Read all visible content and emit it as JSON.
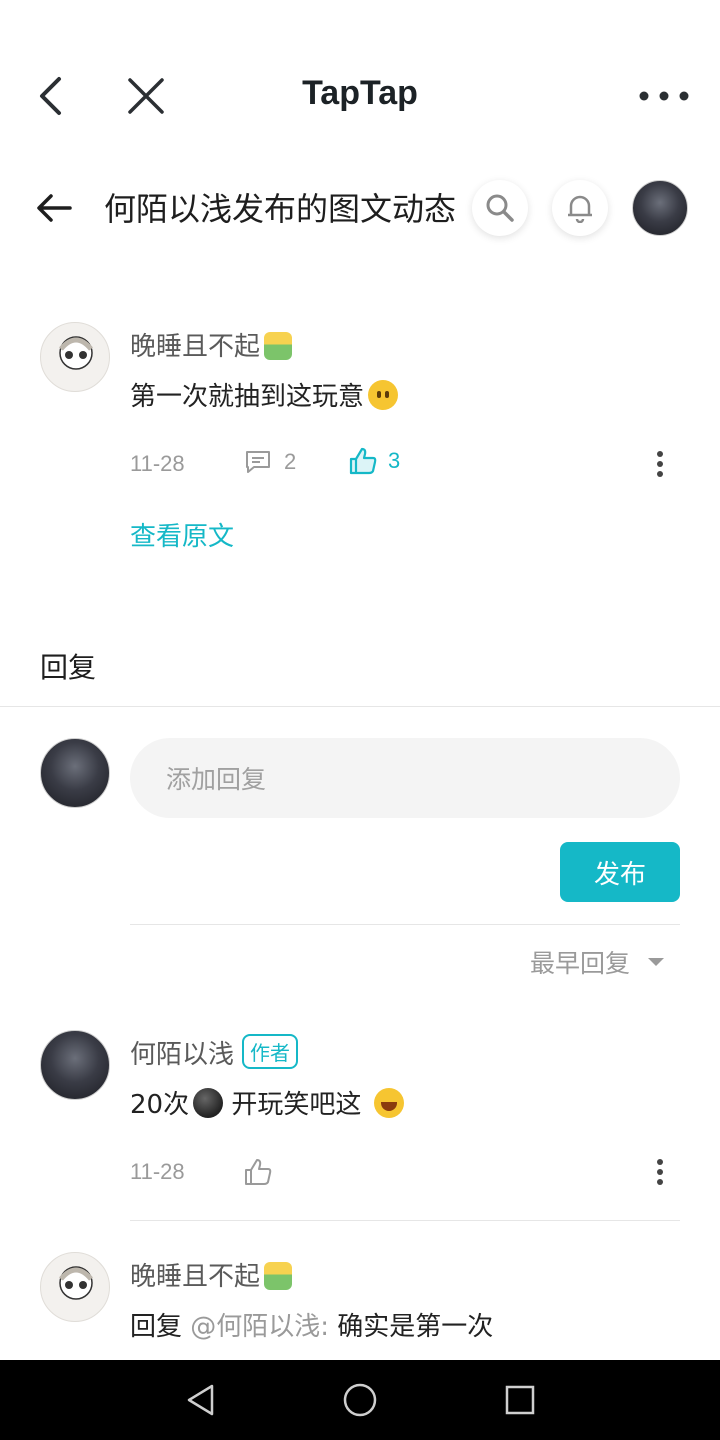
{
  "topbar": {
    "title": "TapTap"
  },
  "subheader": {
    "title": "何陌以浅发布的图文动态"
  },
  "post": {
    "author": "晚睡且不起",
    "text": "第一次就抽到这玩意",
    "date": "11-28",
    "comment_count": "2",
    "like_count": "3",
    "view_original": "查看原文"
  },
  "replies_section": {
    "title": "回复",
    "input_placeholder": "添加回复",
    "publish_label": "发布",
    "sort_label": "最早回复"
  },
  "replies": [
    {
      "author": "何陌以浅",
      "badge": "作者",
      "text_a": "20次",
      "text_b": " 开玩笑吧这 ",
      "date": "11-28"
    },
    {
      "author": "晚睡且不起",
      "reply_prefix": "回复 ",
      "mention": "@何陌以浅:",
      "text": " 确实是第一次"
    }
  ],
  "colors": {
    "accent": "#15b8c7",
    "text": "#222222",
    "muted": "#9a9a9a"
  }
}
